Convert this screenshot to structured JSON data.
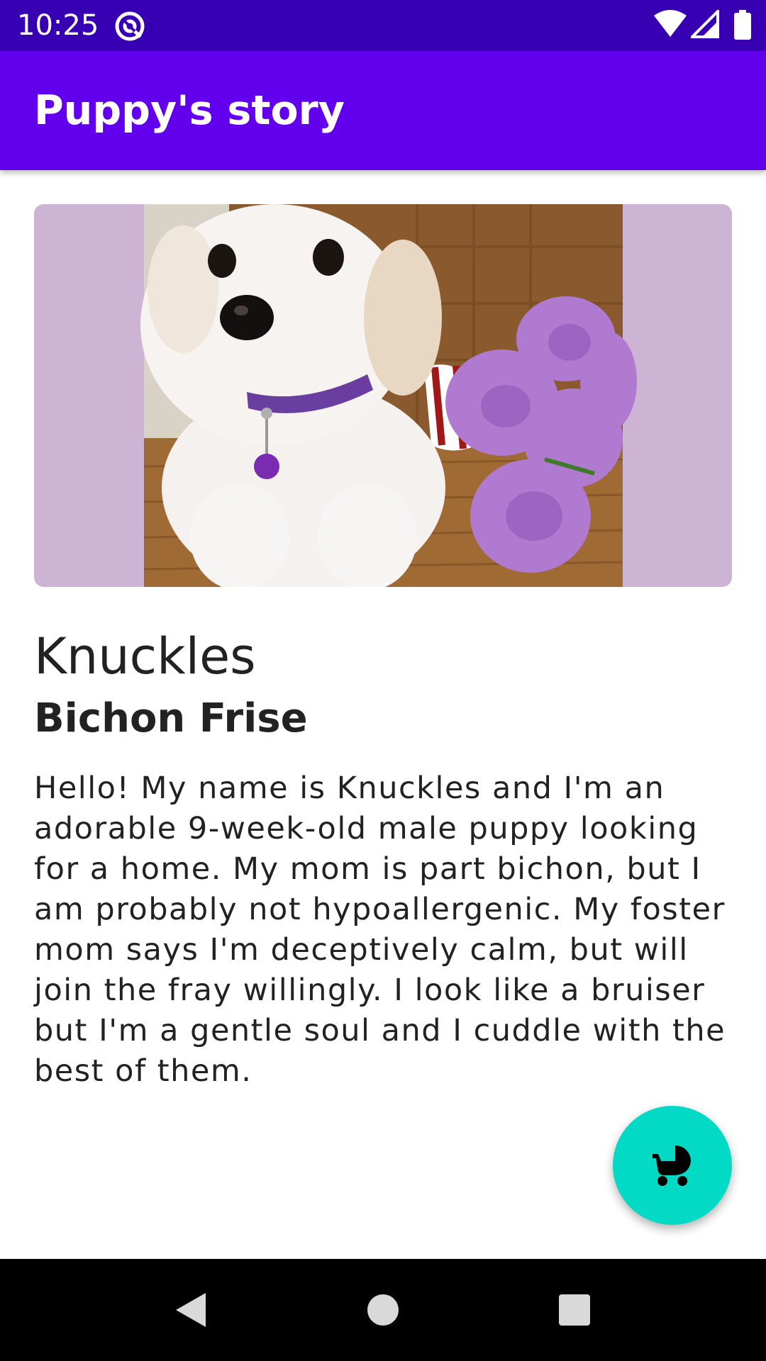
{
  "status_bar": {
    "time": "10:25",
    "app_icon": "at-sign-icon",
    "wifi_icon": "wifi-icon",
    "signal_icon": "signal-icon",
    "battery_icon": "battery-icon"
  },
  "app_bar": {
    "title": "Puppy's story",
    "background": "#6200ee"
  },
  "photo": {
    "description_icon": "puppy-photo"
  },
  "pet": {
    "name": "Knuckles",
    "breed": "Bichon Frise",
    "story": "Hello! My name is Knuckles and I'm an adorable 9-week-old male puppy looking for a home. My mom is part bichon, but I am probably not hypoallergenic. My foster mom says I'm deceptively calm, but will join the fray willingly. I look like a bruiser but I'm a gentle soul and I cuddle with the best of them."
  },
  "fab": {
    "icon": "stroller-icon",
    "color": "#03dac5"
  },
  "nav_bar": {
    "back_icon": "back-triangle-icon",
    "home_icon": "home-circle-icon",
    "recents_icon": "recents-square-icon"
  }
}
